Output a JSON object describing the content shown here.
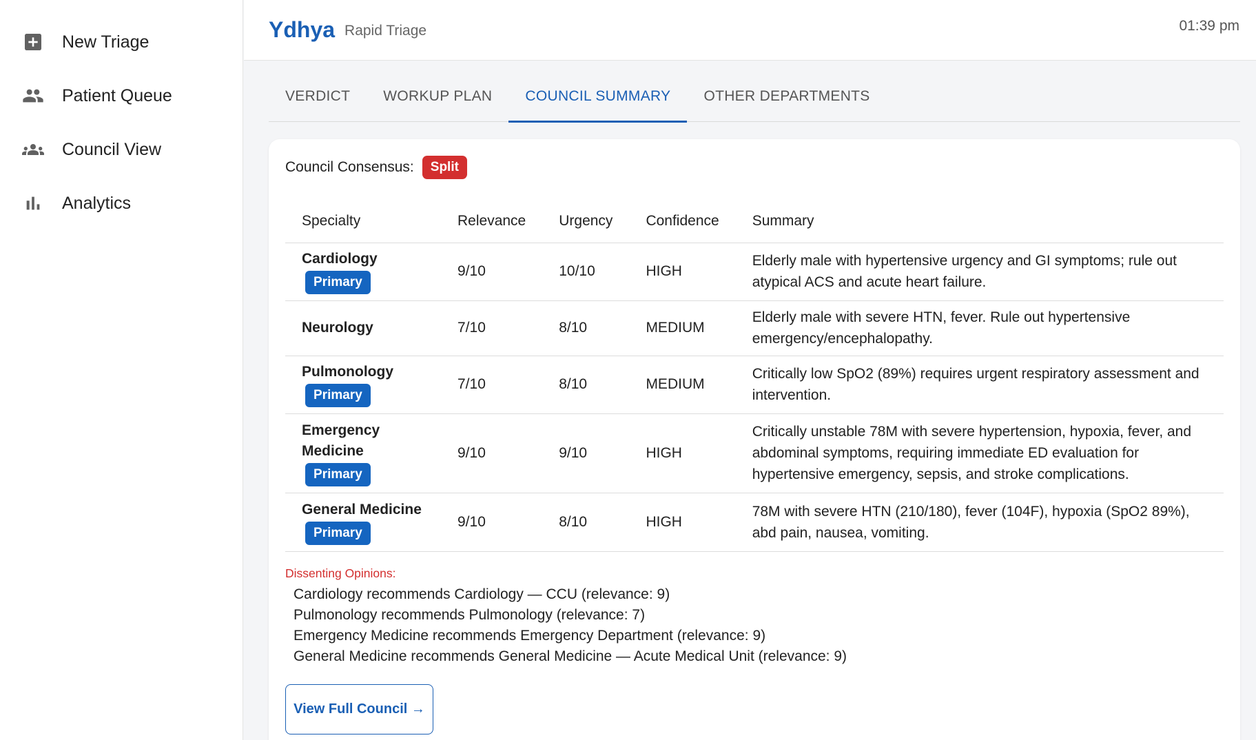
{
  "sidebar": {
    "items": [
      {
        "label": "New Triage",
        "icon": "add-box-icon"
      },
      {
        "label": "Patient Queue",
        "icon": "people-icon"
      },
      {
        "label": "Council View",
        "icon": "groups-icon"
      },
      {
        "label": "Analytics",
        "icon": "bar-chart-icon"
      }
    ]
  },
  "header": {
    "brand": "Ydhya",
    "subtitle": "Rapid Triage",
    "time": "01:39 pm"
  },
  "tabs": [
    {
      "label": "VERDICT",
      "active": false
    },
    {
      "label": "WORKUP PLAN",
      "active": false
    },
    {
      "label": "COUNCIL SUMMARY",
      "active": true
    },
    {
      "label": "OTHER DEPARTMENTS",
      "active": false
    }
  ],
  "card": {
    "consensus_label": "Council Consensus:",
    "consensus_value": "Split",
    "columns": [
      "Specialty",
      "Relevance",
      "Urgency",
      "Confidence",
      "Summary"
    ],
    "primary_label": "Primary",
    "rows": [
      {
        "specialty": "Cardiology",
        "primary": true,
        "relevance": "9/10",
        "urgency": "10/10",
        "confidence": "HIGH",
        "summary": "Elderly male with hypertensive urgency and GI symptoms; rule out atypical ACS and acute heart failure."
      },
      {
        "specialty": "Neurology",
        "primary": false,
        "relevance": "7/10",
        "urgency": "8/10",
        "confidence": "MEDIUM",
        "summary": "Elderly male with severe HTN, fever. Rule out hypertensive emergency/encephalopathy."
      },
      {
        "specialty": "Pulmonology",
        "primary": true,
        "relevance": "7/10",
        "urgency": "8/10",
        "confidence": "MEDIUM",
        "summary": "Critically low SpO2 (89%) requires urgent respiratory assessment and intervention."
      },
      {
        "specialty": "Emergency Medicine",
        "primary": true,
        "relevance": "9/10",
        "urgency": "9/10",
        "confidence": "HIGH",
        "summary": "Critically unstable 78M with severe hypertension, hypoxia, fever, and abdominal symptoms, requiring immediate ED evaluation for hypertensive emergency, sepsis, and stroke complications."
      },
      {
        "specialty": "General Medicine",
        "primary": true,
        "relevance": "9/10",
        "urgency": "8/10",
        "confidence": "HIGH",
        "summary": "78M with severe HTN (210/180), fever (104F), hypoxia (SpO2 89%), abd pain, nausea, vomiting."
      }
    ],
    "dissent_title": "Dissenting Opinions:",
    "dissent": [
      "Cardiology recommends Cardiology — CCU (relevance: 9)",
      "Pulmonology recommends Pulmonology (relevance: 7)",
      "Emergency Medicine recommends Emergency Department (relevance: 9)",
      "General Medicine recommends General Medicine — Acute Medical Unit (relevance: 9)"
    ],
    "view_button": "View Full Council →"
  },
  "colors": {
    "accent": "#1a5fb4",
    "split_badge": "#d32f2f",
    "primary_badge": "#1565c0",
    "dissent_title": "#d32f2f"
  }
}
